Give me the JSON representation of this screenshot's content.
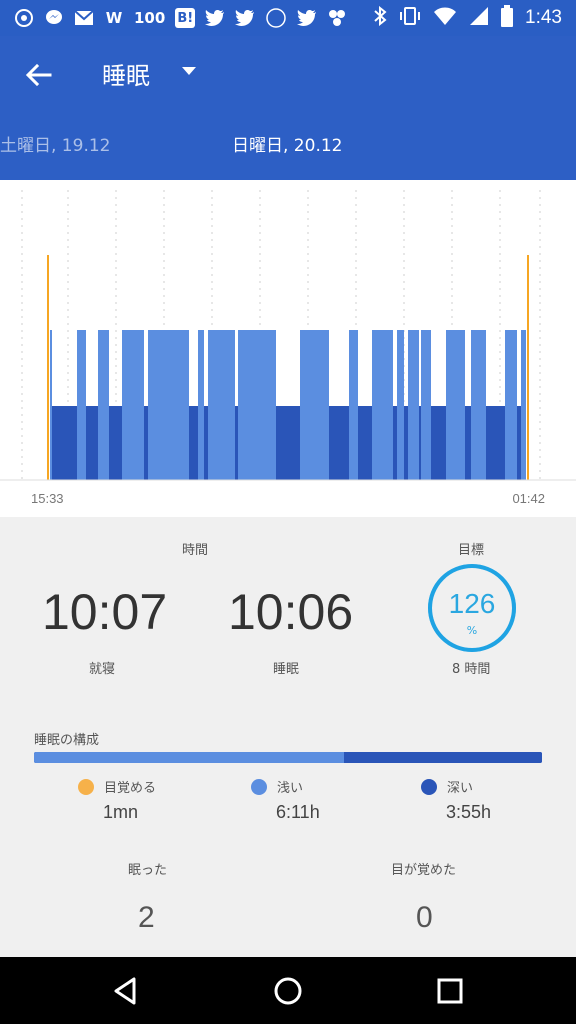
{
  "status_bar": {
    "icons": [
      "whatsapp-icon",
      "messenger-icon",
      "gmail-icon",
      "wordpress-icon",
      "100-icon",
      "hatena-icon",
      "twitter-icon",
      "twitter-icon",
      "575-icon",
      "twitter-icon",
      "pinwheel-icon",
      "bluetooth-icon",
      "vibrate-icon",
      "wifi-icon",
      "signal-icon",
      "battery-icon"
    ],
    "badge_w": "W",
    "badge_100": "100",
    "badge_b": "B!",
    "time": "1:43"
  },
  "header": {
    "title": "睡眠",
    "prev_day": "土曜日, 19.12",
    "current_day": "日曜日, 20.12"
  },
  "chart_data": {
    "type": "bar",
    "start_time": "15:33",
    "end_time": "01:42",
    "stages": [
      "awake",
      "light",
      "deep"
    ],
    "colors": {
      "awake": "#f6a623",
      "light": "#5b8ee0",
      "deep": "#2a55b8"
    }
  },
  "stats": {
    "time_header": "時間",
    "goal_header": "目標",
    "bedtime_value": "10:07",
    "bedtime_label": "就寝",
    "sleep_value": "10:06",
    "sleep_label": "睡眠",
    "goal_percent": "126",
    "goal_percent_unit": "%",
    "goal_hours": "8 時間",
    "goal_progress": 1.0
  },
  "composition": {
    "label": "睡眠の構成",
    "light_fraction": 0.61,
    "awake": {
      "label": "目覚める",
      "value": "1mn",
      "color": "#f6b14a"
    },
    "light": {
      "label": "浅い",
      "value": "6:11h",
      "color": "#5b8ee0"
    },
    "deep": {
      "label": "深い",
      "value": "3:55h",
      "color": "#2a55b8"
    }
  },
  "counts": {
    "slept_label": "眠った",
    "slept_value": "2",
    "woke_label": "目が覚めた",
    "woke_value": "0"
  }
}
